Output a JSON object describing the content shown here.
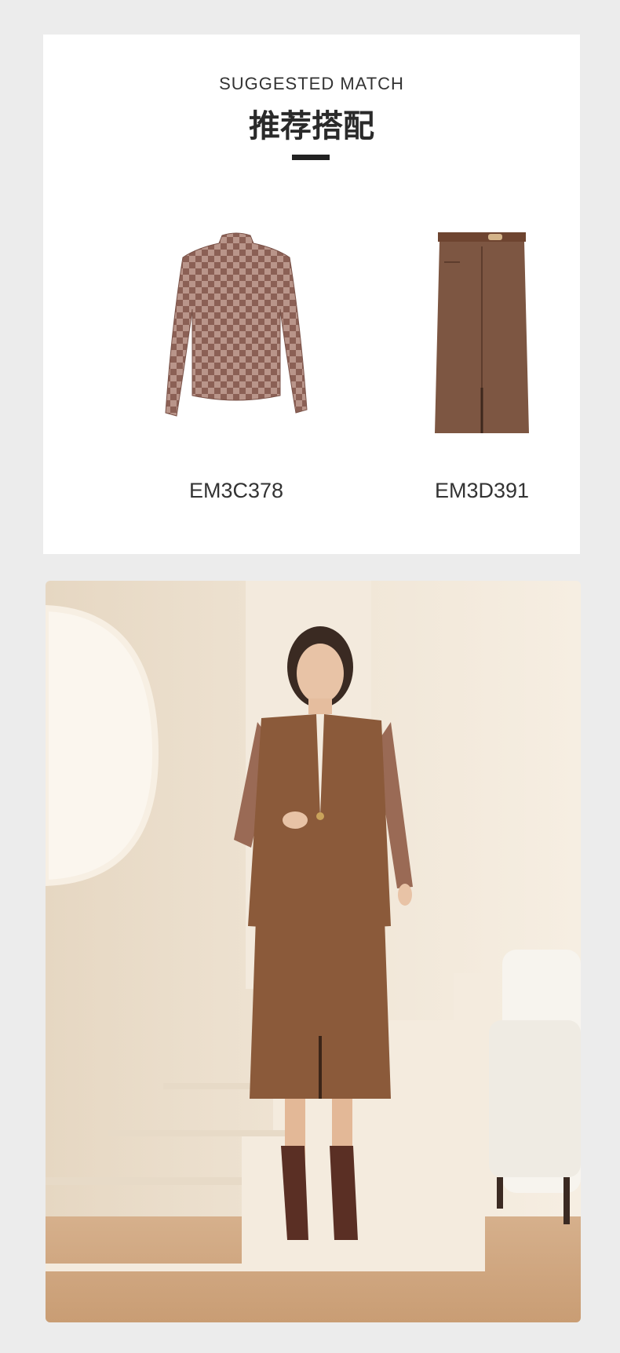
{
  "header": {
    "subtitle": "SUGGESTED MATCH",
    "title": "推荐搭配"
  },
  "products": [
    {
      "code": "EM3C378",
      "icon": "top-garment-icon"
    },
    {
      "code": "EM3D391",
      "icon": "skirt-garment-icon"
    }
  ],
  "colors": {
    "background": "#ececec",
    "card": "#ffffff",
    "brown": "#8a5a3c",
    "wall": "#efe3d2"
  }
}
